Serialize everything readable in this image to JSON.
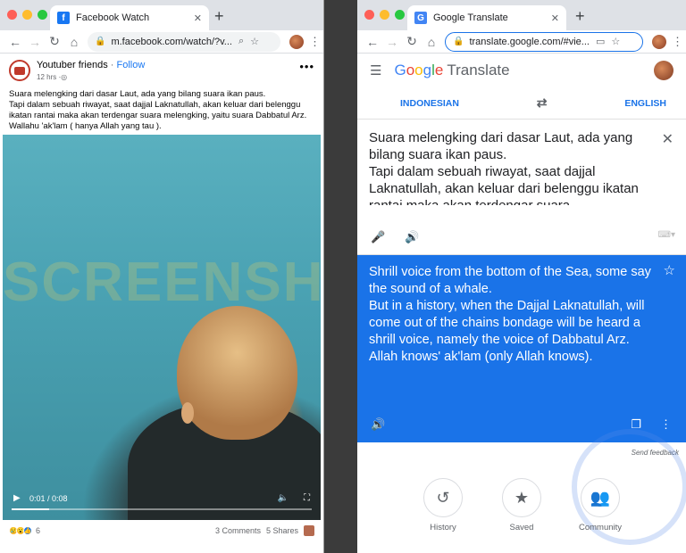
{
  "left": {
    "tab_title": "Facebook Watch",
    "url": "m.facebook.com/watch/?v...",
    "post": {
      "page_name": "Youtuber friends",
      "follow": "Follow",
      "time": "12 hrs",
      "text": "Suara melengking dari dasar Laut, ada yang bilang suara ikan paus.\nTapi dalam sebuah riwayat, saat dajjal Laknatullah, akan keluar dari belenggu ikatan rantai maka akan terdengar suara melengking, yaitu suara Dabbatul Arz. Wallahu 'ak'lam ( hanya Allah yang tau ).",
      "video_time": "0:01 / 0:08",
      "progress": 0.125,
      "watermark": "SCREENSHOT",
      "reaction_count": "6",
      "comments": "3 Comments",
      "shares": "5 Shares"
    }
  },
  "right": {
    "tab_title": "Google Translate",
    "url": "translate.google.com/#vie...",
    "product": "Translate",
    "source_lang": "INDONESIAN",
    "target_lang": "ENGLISH",
    "source_text": "Suara melengking dari dasar Laut, ada yang bilang suara ikan paus.\nTapi dalam sebuah riwayat, saat dajjal Laknatullah, akan keluar dari belenggu ikatan rantai maka akan terdengar suara",
    "translation": "Shrill voice from the bottom of the Sea, some say the sound of a whale.\nBut in a history, when the Dajjal Laknatullah, will come out of the chains bondage will be heard a shrill voice, namely the voice of Dabbatul Arz. Allah knows' ak'lam (only Allah knows).",
    "send_feedback": "Send feedback",
    "bottom": [
      "History",
      "Saved",
      "Community"
    ]
  },
  "colors": {
    "fb_blue": "#1877f2",
    "gt_blue": "#1a73e8"
  }
}
